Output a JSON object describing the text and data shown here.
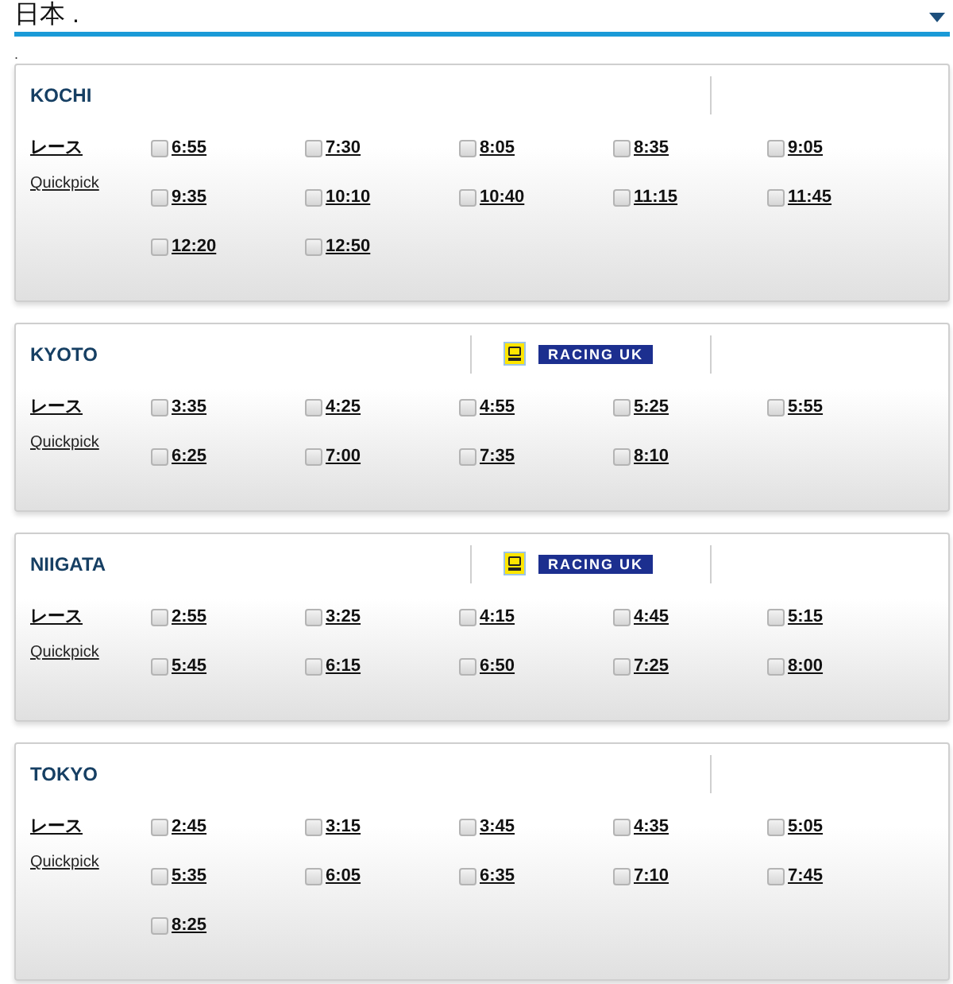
{
  "country_select": {
    "value": "日本 ."
  },
  "note": ".",
  "meetings": [
    {
      "name": "KOCHI",
      "races_label": "レース",
      "quickpick_label": "Quickpick",
      "races": [
        {
          "time": "6:55",
          "checked": false
        },
        {
          "time": "7:30",
          "checked": false
        },
        {
          "time": "8:05",
          "checked": false
        },
        {
          "time": "8:35",
          "checked": false
        },
        {
          "time": "9:05",
          "checked": false
        },
        {
          "time": "9:35",
          "checked": false
        },
        {
          "time": "10:10",
          "checked": false
        },
        {
          "time": "10:40",
          "checked": false
        },
        {
          "time": "11:15",
          "checked": false
        },
        {
          "time": "11:45",
          "checked": false
        },
        {
          "time": "12:20",
          "checked": false
        },
        {
          "time": "12:50",
          "checked": false
        }
      ]
    },
    {
      "name": "KYOTO",
      "broadcaster": "RACING UK",
      "races_label": "レース",
      "quickpick_label": "Quickpick",
      "races": [
        {
          "time": "3:35",
          "checked": false
        },
        {
          "time": "4:25",
          "checked": false
        },
        {
          "time": "4:55",
          "checked": false
        },
        {
          "time": "5:25",
          "checked": false
        },
        {
          "time": "5:55",
          "checked": false
        },
        {
          "time": "6:25",
          "checked": false
        },
        {
          "time": "7:00",
          "checked": false
        },
        {
          "time": "7:35",
          "checked": false
        },
        {
          "time": "8:10",
          "checked": false
        }
      ]
    },
    {
      "name": "NIIGATA",
      "broadcaster": "RACING UK",
      "races_label": "レース",
      "quickpick_label": "Quickpick",
      "races": [
        {
          "time": "2:55",
          "checked": false
        },
        {
          "time": "3:25",
          "checked": false
        },
        {
          "time": "4:15",
          "checked": false
        },
        {
          "time": "4:45",
          "checked": false
        },
        {
          "time": "5:15",
          "checked": false
        },
        {
          "time": "5:45",
          "checked": false
        },
        {
          "time": "6:15",
          "checked": false
        },
        {
          "time": "6:50",
          "checked": false
        },
        {
          "time": "7:25",
          "checked": false
        },
        {
          "time": "8:00",
          "checked": false
        }
      ]
    },
    {
      "name": "TOKYO",
      "races_label": "レース",
      "quickpick_label": "Quickpick",
      "races": [
        {
          "time": "2:45",
          "checked": false
        },
        {
          "time": "3:15",
          "checked": false
        },
        {
          "time": "3:45",
          "checked": false
        },
        {
          "time": "4:35",
          "checked": false
        },
        {
          "time": "5:05",
          "checked": false
        },
        {
          "time": "5:35",
          "checked": false
        },
        {
          "time": "6:05",
          "checked": false
        },
        {
          "time": "6:35",
          "checked": false
        },
        {
          "time": "7:10",
          "checked": false
        },
        {
          "time": "7:45",
          "checked": false
        },
        {
          "time": "8:25",
          "checked": false
        }
      ]
    }
  ]
}
